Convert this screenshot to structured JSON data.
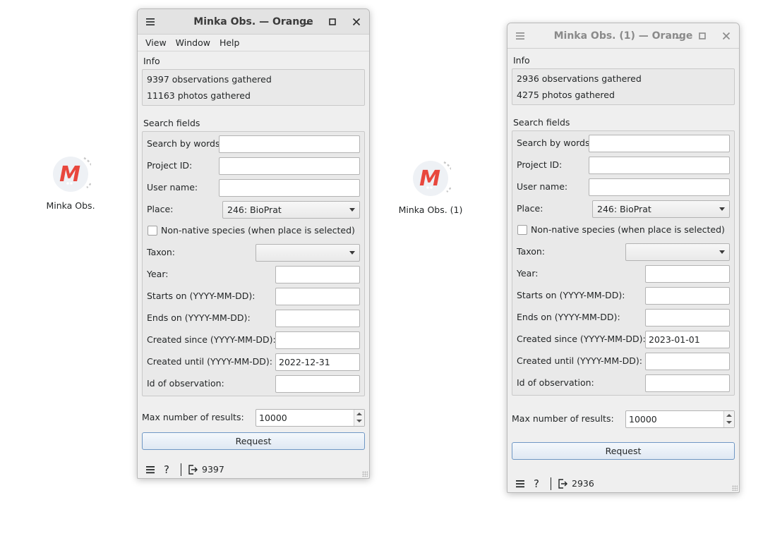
{
  "nodes": [
    {
      "label": "Minka Obs."
    },
    {
      "label": "Minka Obs. (1)"
    }
  ],
  "icon_colors": {
    "brand_red": "#e8473d",
    "ring": "#d0d0d0"
  },
  "window1": {
    "title": "Minka Obs. — Orange",
    "menu": [
      "View",
      "Window",
      "Help"
    ],
    "info_title": "Info",
    "info_lines": [
      "9397 observations gathered",
      "11163 photos gathered"
    ],
    "search_title": "Search fields",
    "fields": {
      "search_words": {
        "label": "Search by words:",
        "value": ""
      },
      "project_id": {
        "label": "Project ID:",
        "value": ""
      },
      "user_name": {
        "label": "User name:",
        "value": ""
      },
      "place": {
        "label": "Place:",
        "value": "246: BioPrat"
      },
      "non_native": {
        "label": "Non-native species (when place is selected)",
        "checked": false
      },
      "taxon": {
        "label": "Taxon:",
        "value": ""
      },
      "year": {
        "label": "Year:",
        "value": ""
      },
      "starts_on": {
        "label": "Starts on (YYYY-MM-DD):",
        "value": ""
      },
      "ends_on": {
        "label": "Ends on (YYYY-MM-DD):",
        "value": ""
      },
      "created_since": {
        "label": "Created since (YYYY-MM-DD):",
        "value": ""
      },
      "created_until": {
        "label": "Created until (YYYY-MM-DD):",
        "value": "2022-12-31"
      },
      "obs_id": {
        "label": "Id of observation:",
        "value": ""
      }
    },
    "max_results": {
      "label": "Max number of results:",
      "value": "10000"
    },
    "request_label": "Request",
    "status_count": "9397"
  },
  "window2": {
    "title": "Minka Obs. (1) — Orange",
    "info_title": "Info",
    "info_lines": [
      "2936 observations gathered",
      "4275 photos gathered"
    ],
    "search_title": "Search fields",
    "fields": {
      "search_words": {
        "label": "Search by words:",
        "value": ""
      },
      "project_id": {
        "label": "Project ID:",
        "value": ""
      },
      "user_name": {
        "label": "User name:",
        "value": ""
      },
      "place": {
        "label": "Place:",
        "value": "246: BioPrat"
      },
      "non_native": {
        "label": "Non-native species (when place is selected)",
        "checked": false
      },
      "taxon": {
        "label": "Taxon:",
        "value": ""
      },
      "year": {
        "label": "Year:",
        "value": ""
      },
      "starts_on": {
        "label": "Starts on (YYYY-MM-DD):",
        "value": ""
      },
      "ends_on": {
        "label": "Ends on (YYYY-MM-DD):",
        "value": ""
      },
      "created_since": {
        "label": "Created since (YYYY-MM-DD):",
        "value": "2023-01-01"
      },
      "created_until": {
        "label": "Created until (YYYY-MM-DD):",
        "value": ""
      },
      "obs_id": {
        "label": "Id of observation:",
        "value": ""
      }
    },
    "max_results": {
      "label": "Max number of results:",
      "value": "10000"
    },
    "request_label": "Request",
    "status_count": "2936"
  }
}
